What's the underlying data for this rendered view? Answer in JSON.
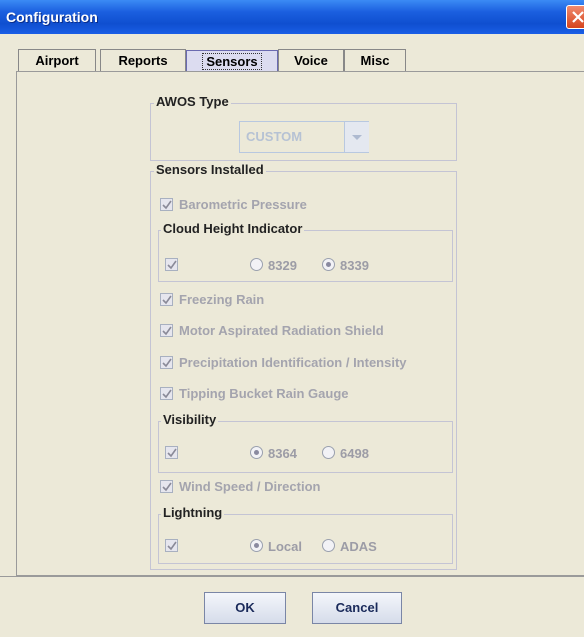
{
  "window": {
    "title": "Configuration"
  },
  "tabs": [
    {
      "label": "Airport"
    },
    {
      "label": "Reports"
    },
    {
      "label": "Sensors",
      "selected": true
    },
    {
      "label": "Voice"
    },
    {
      "label": "Misc"
    }
  ],
  "awos": {
    "legend": "AWOS Type",
    "selected": "CUSTOM"
  },
  "sensors": {
    "legend": "Sensors Installed",
    "barometric": {
      "label": "Barometric Pressure",
      "checked": true
    },
    "cloud_height": {
      "legend": "Cloud Height Indicator",
      "checked": true,
      "options": [
        "8329",
        "8339"
      ],
      "selected": "8339"
    },
    "freezing_rain": {
      "label": "Freezing Rain",
      "checked": true
    },
    "motor_aspirated": {
      "label": "Motor Aspirated Radiation Shield",
      "checked": true
    },
    "precipitation": {
      "label": "Precipitation Identification / Intensity",
      "checked": true
    },
    "tipping_bucket": {
      "label": "Tipping Bucket Rain Gauge",
      "checked": true
    },
    "visibility": {
      "legend": "Visibility",
      "checked": true,
      "options": [
        "8364",
        "6498"
      ],
      "selected": "8364"
    },
    "wind": {
      "label": "Wind Speed / Direction",
      "checked": true
    },
    "lightning": {
      "legend": "Lightning",
      "checked": true,
      "options": [
        "Local",
        "ADAS"
      ],
      "selected": "Local"
    }
  },
  "buttons": {
    "ok": "OK",
    "cancel": "Cancel"
  },
  "colors": {
    "title_bar": "#1b5fdf",
    "disabled_text": "#a4a4ae",
    "panel": "#ece9d8"
  }
}
